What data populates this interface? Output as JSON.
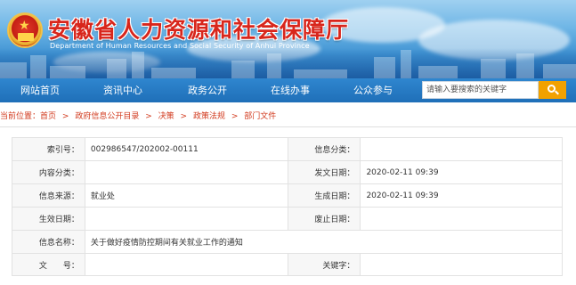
{
  "header": {
    "title": "安徽省人力资源和社会保障厅",
    "subtitle": "Department of Human Resources and Social Security of Anhui Province",
    "emblem_icon": "national-emblem-icon"
  },
  "nav": {
    "items": [
      {
        "label": "网站首页"
      },
      {
        "label": "资讯中心"
      },
      {
        "label": "政务公开"
      },
      {
        "label": "在线办事"
      },
      {
        "label": "公众参与"
      }
    ],
    "bg_color": "#2a7cc4"
  },
  "search": {
    "placeholder": "请输入要搜索的关键字",
    "button_icon": "search-icon",
    "button_color": "#f2a100"
  },
  "breadcrumb": {
    "prefix": "当前位置：",
    "items": [
      "首页",
      "政府信息公开目录",
      "决策",
      "政策法规",
      "部门文件"
    ],
    "separator": ">"
  },
  "info": {
    "rows": [
      {
        "label1": "索引号：",
        "value1": "002986547/202002-00111",
        "label2": "信息分类：",
        "value2": ""
      },
      {
        "label1": "内容分类：",
        "value1": "",
        "label2": "发文日期：",
        "value2": "2020-02-11 09:39"
      },
      {
        "label1": "信息来源：",
        "value1": "就业处",
        "label2": "生成日期：",
        "value2": "2020-02-11 09:39"
      },
      {
        "label1": "生效日期：",
        "value1": "",
        "label2": "废止日期：",
        "value2": ""
      },
      {
        "label1": "信息名称：",
        "value1": "关于做好疫情防控期间有关就业工作的通知",
        "label2": "",
        "value2": ""
      },
      {
        "label1": "文　　号：",
        "value1": "",
        "label2": "关键字：",
        "value2": ""
      }
    ]
  }
}
